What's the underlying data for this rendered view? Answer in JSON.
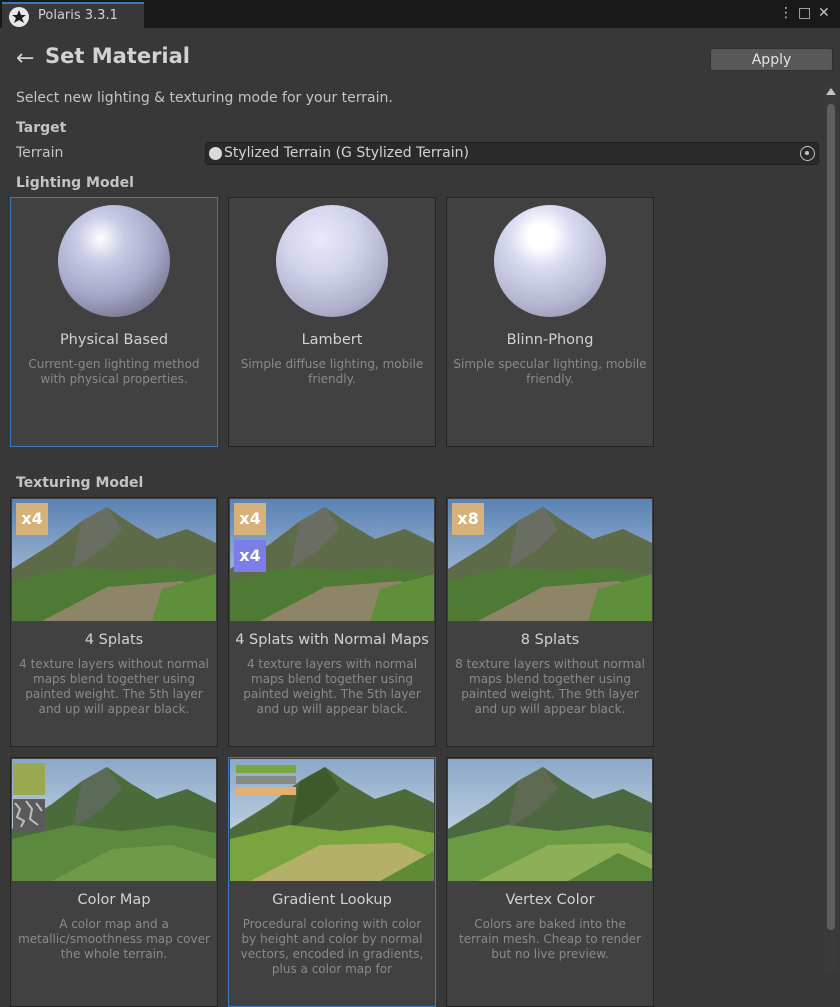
{
  "window": {
    "tab_title": "Polaris 3.3.1",
    "controls": {
      "menu": "⋮",
      "maximize": "□",
      "close": "✕"
    }
  },
  "header": {
    "back_icon": "←",
    "title": "Set Material",
    "apply_label": "Apply"
  },
  "description": "Select new lighting & texturing mode for your terrain.",
  "target": {
    "heading": "Target",
    "label": "Terrain",
    "value": "Stylized Terrain (G Stylized Terrain)"
  },
  "lighting": {
    "heading": "Lighting Model",
    "items": [
      {
        "title": "Physical Based",
        "desc": "Current-gen lighting method with physical properties.",
        "selected": true
      },
      {
        "title": "Lambert",
        "desc": "Simple diffuse lighting, mobile friendly.",
        "selected": false
      },
      {
        "title": "Blinn-Phong",
        "desc": "Simple specular lighting, mobile friendly.",
        "selected": false
      }
    ]
  },
  "texturing": {
    "heading": "Texturing Model",
    "items": [
      {
        "title": "4 Splats",
        "desc": "4 texture layers without normal maps blend together using painted weight. The 5th layer and up will appear black.",
        "badges": [
          "x4"
        ]
      },
      {
        "title": "4 Splats with Normal Maps",
        "desc": "4 texture layers with normal maps blend together using painted weight. The 5th layer and up will appear black.",
        "badges": [
          "x4",
          "x4"
        ]
      },
      {
        "title": "8 Splats",
        "desc": "8 texture layers without normal maps blend together using painted weight. The 9th layer and up will appear black.",
        "badges": [
          "x8"
        ]
      },
      {
        "title": "Color Map",
        "desc": "A color map and a metallic/smoothness map cover the whole terrain."
      },
      {
        "title": "Gradient Lookup",
        "desc": "Procedural coloring with color by height and color by normal vectors, encoded in gradients, plus a color map for"
      },
      {
        "title": "Vertex Color",
        "desc": "Colors are baked into the terrain mesh. Cheap to render but no live preview."
      }
    ]
  },
  "colors": {
    "accent": "#3a79bb",
    "background": "#383838",
    "card": "#414141",
    "badge_albedo": "#d6b27a",
    "badge_normal": "#7b7de8"
  }
}
